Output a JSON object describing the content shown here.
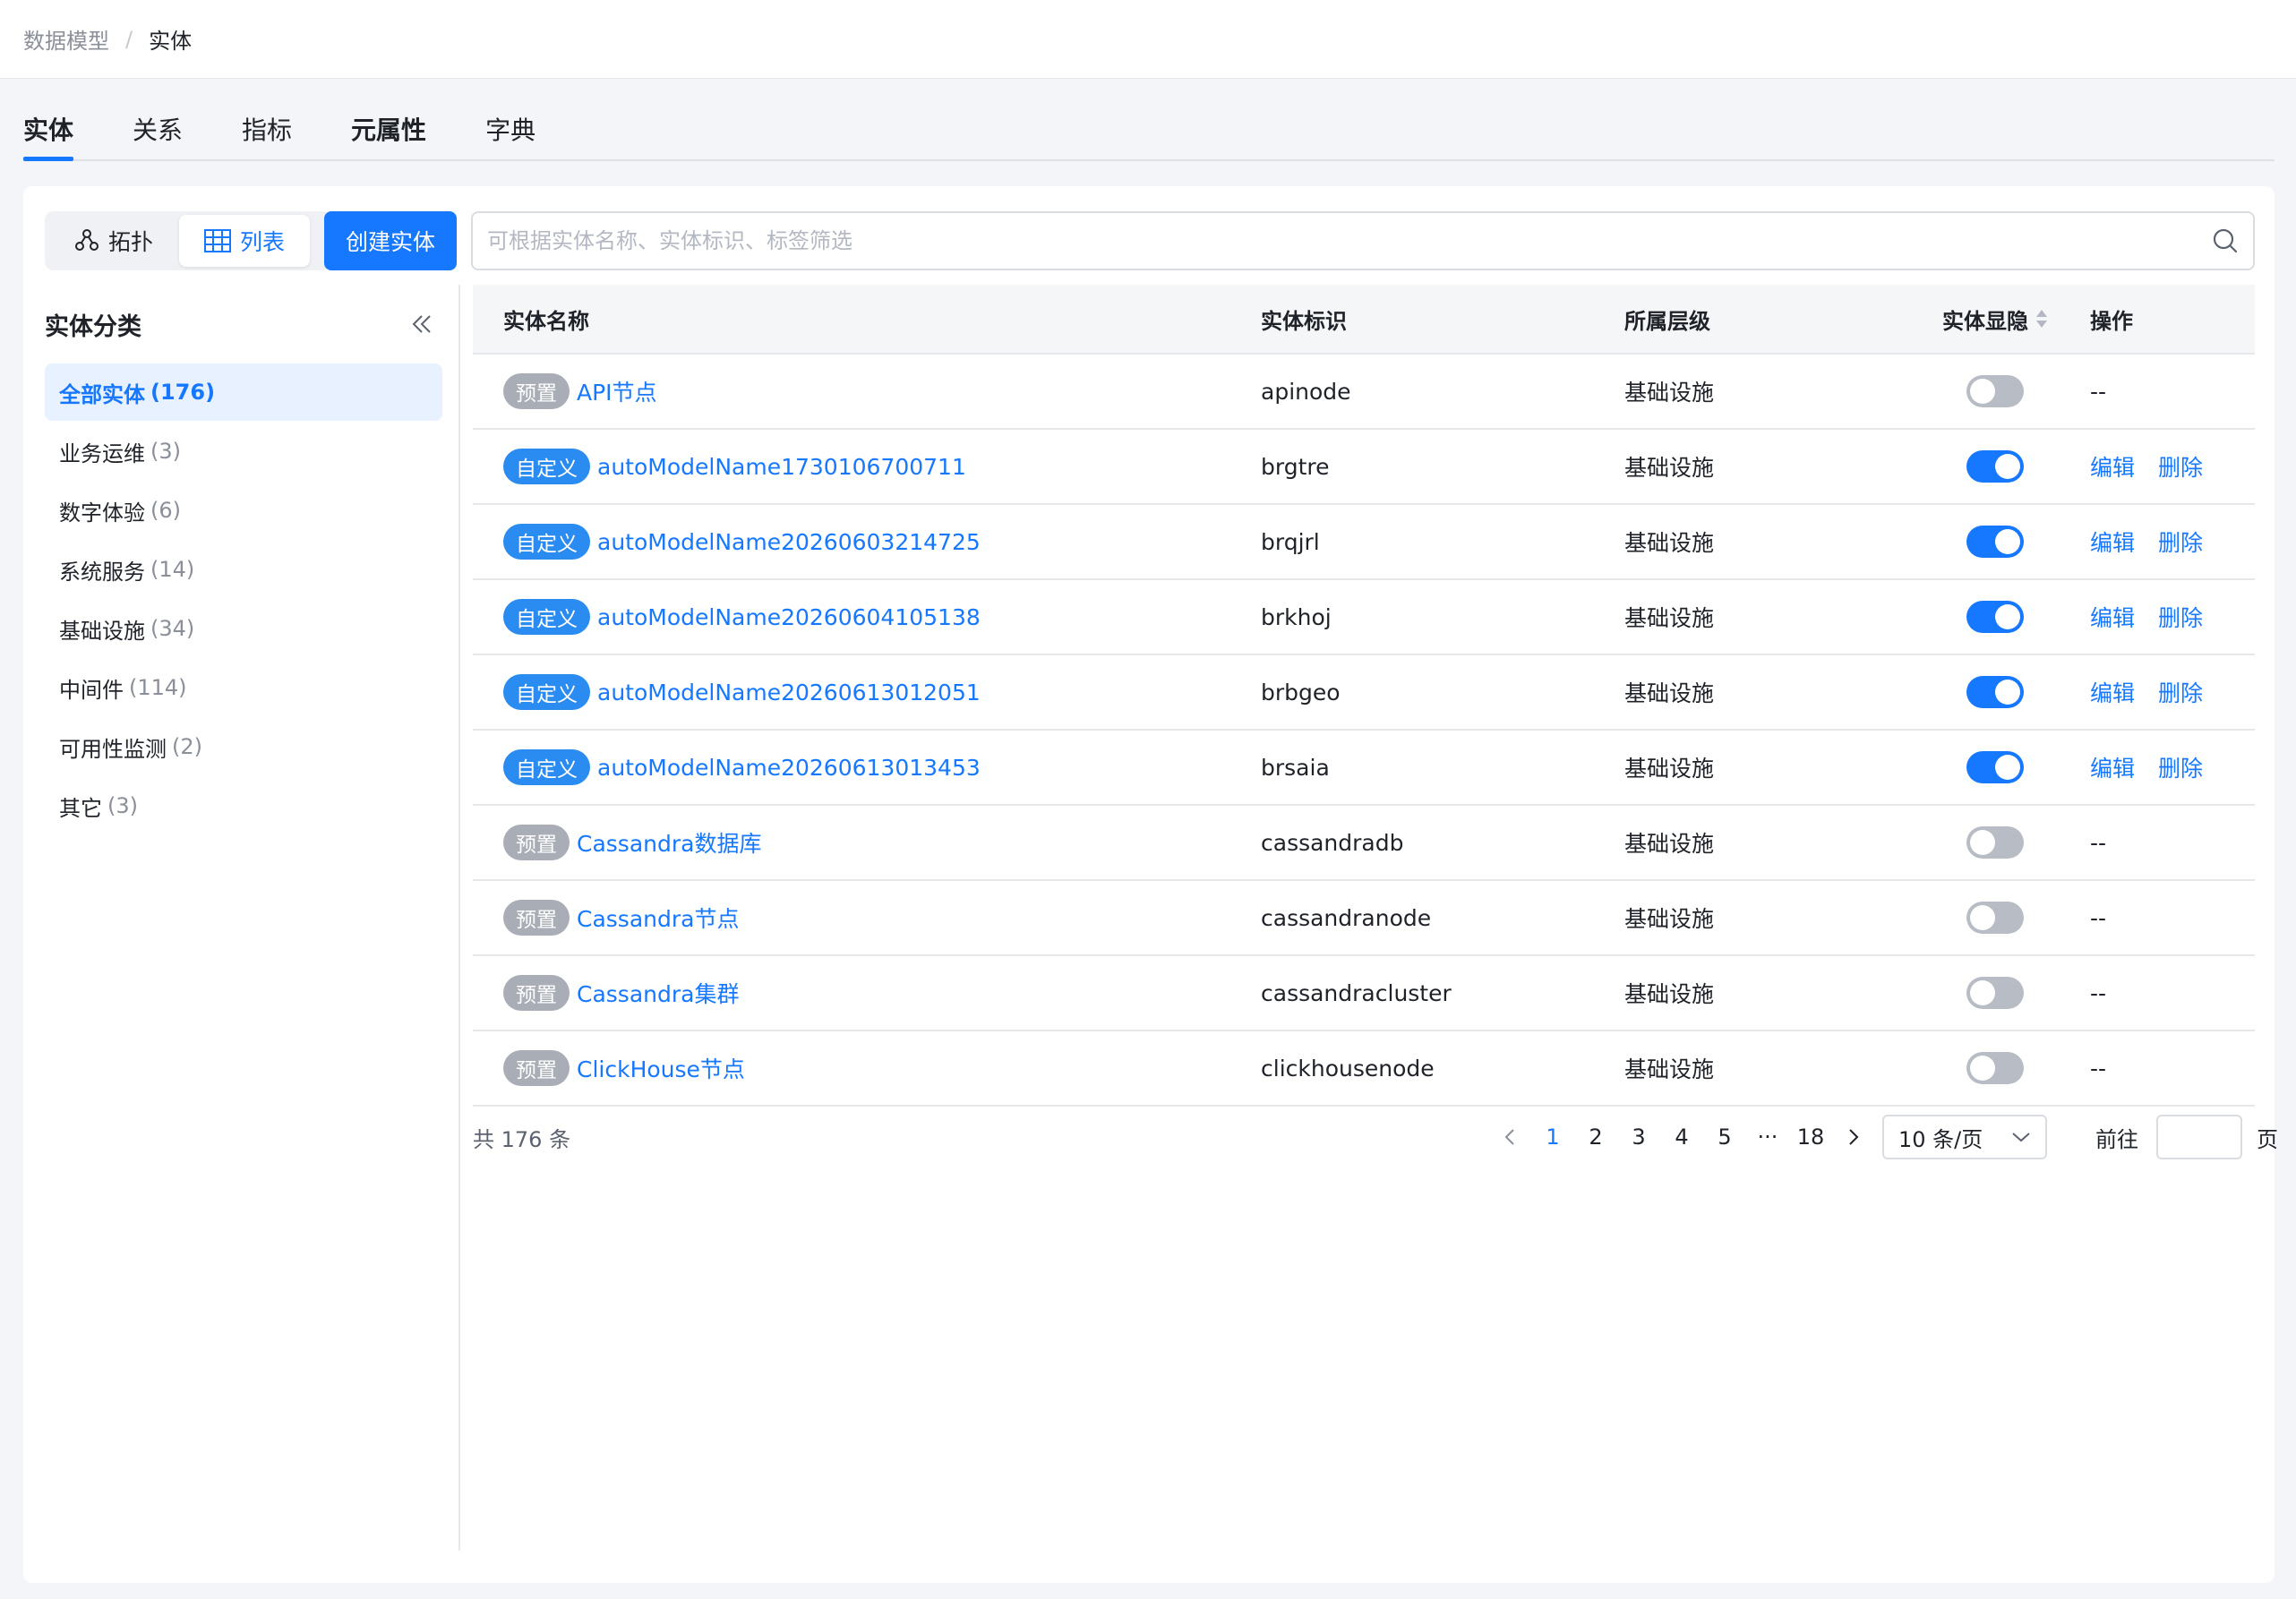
{
  "breadcrumb": {
    "parent": "数据模型",
    "separator": "/",
    "current": "实体"
  },
  "tabs": [
    {
      "label": "实体",
      "active": true
    },
    {
      "label": "关系"
    },
    {
      "label": "指标"
    },
    {
      "label": "元属性"
    },
    {
      "label": "字典"
    }
  ],
  "toolbar": {
    "topology_label": "拓扑",
    "list_label": "列表",
    "create_label": "创建实体",
    "search_placeholder": "可根据实体名称、实体标识、标签筛选"
  },
  "sidebar": {
    "title": "实体分类",
    "items": [
      {
        "label": "全部实体",
        "count": "(176)",
        "active": true
      },
      {
        "label": "业务运维",
        "count": "(3)"
      },
      {
        "label": "数字体验",
        "count": "(6)"
      },
      {
        "label": "系统服务",
        "count": "(14)"
      },
      {
        "label": "基础设施",
        "count": "(34)"
      },
      {
        "label": "中间件",
        "count": "(114)"
      },
      {
        "label": "可用性监测",
        "count": "(2)"
      },
      {
        "label": "其它",
        "count": "(3)"
      }
    ]
  },
  "table": {
    "headers": {
      "name": "实体名称",
      "id": "实体标识",
      "level": "所属层级",
      "visible": "实体显隐",
      "op": "操作"
    },
    "op_edit": "编辑",
    "op_delete": "删除",
    "op_none": "--",
    "rows": [
      {
        "tag": "预置",
        "tag_type": "preset",
        "name": "API节点",
        "id": "apinode",
        "level": "基础设施",
        "visible": false
      },
      {
        "tag": "自定义",
        "tag_type": "custom",
        "name": "autoModelName1730106700711",
        "id": "brgtre",
        "level": "基础设施",
        "visible": true
      },
      {
        "tag": "自定义",
        "tag_type": "custom",
        "name": "autoModelName20260603214725",
        "id": "brqjrl",
        "level": "基础设施",
        "visible": true
      },
      {
        "tag": "自定义",
        "tag_type": "custom",
        "name": "autoModelName20260604105138",
        "id": "brkhoj",
        "level": "基础设施",
        "visible": true
      },
      {
        "tag": "自定义",
        "tag_type": "custom",
        "name": "autoModelName20260613012051",
        "id": "brbgeo",
        "level": "基础设施",
        "visible": true
      },
      {
        "tag": "自定义",
        "tag_type": "custom",
        "name": "autoModelName20260613013453",
        "id": "brsaia",
        "level": "基础设施",
        "visible": true
      },
      {
        "tag": "预置",
        "tag_type": "preset",
        "name": "Cassandra数据库",
        "id": "cassandradb",
        "level": "基础设施",
        "visible": false
      },
      {
        "tag": "预置",
        "tag_type": "preset",
        "name": "Cassandra节点",
        "id": "cassandranode",
        "level": "基础设施",
        "visible": false
      },
      {
        "tag": "预置",
        "tag_type": "preset",
        "name": "Cassandra集群",
        "id": "cassandracluster",
        "level": "基础设施",
        "visible": false
      },
      {
        "tag": "预置",
        "tag_type": "preset",
        "name": "ClickHouse节点",
        "id": "clickhousenode",
        "level": "基础设施",
        "visible": false
      }
    ]
  },
  "pagination": {
    "total_text": "共 176 条",
    "pages": [
      "1",
      "2",
      "3",
      "4",
      "5"
    ],
    "ellipsis": "···",
    "last_page": "18",
    "current_page": "1",
    "page_size": "10 条/页",
    "goto_label": "前往",
    "goto_unit": "页"
  },
  "colors": {
    "accent": "#1677ff",
    "preset_tag": "#a9adb6",
    "custom_tag": "#2a8cf0"
  }
}
